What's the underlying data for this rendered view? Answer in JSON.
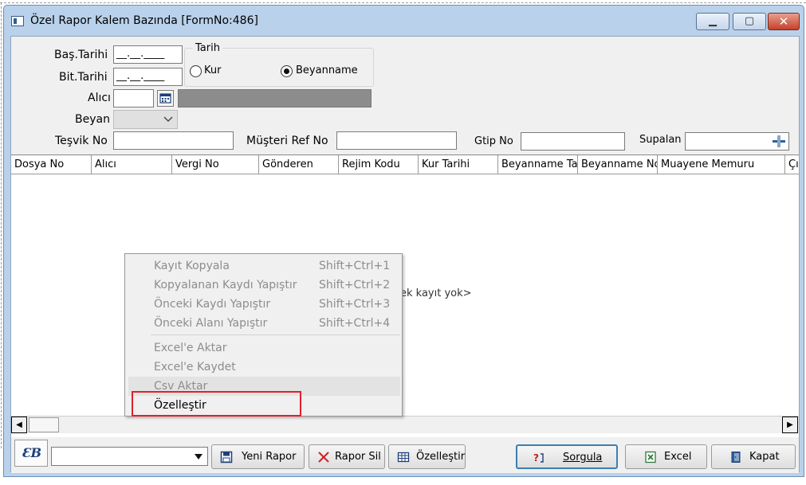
{
  "window": {
    "title": "Özel Rapor Kalem Bazında [FormNo:486]",
    "min_glyph": "▁",
    "max_glyph": "▢",
    "close_glyph": "✕"
  },
  "form": {
    "bas_tarihi_label": "Baş.Tarihi",
    "bas_tarihi_value": "__.__.____",
    "bit_tarihi_label": "Bit.Tarihi",
    "bit_tarihi_value": "__.__.____",
    "tarih_group_label": "Tarih",
    "radio_kur_label": "Kur",
    "radio_beyanname_label": "Beyanname",
    "alici_label": "Alıcı",
    "alici_value": "",
    "beyan_label": "Beyan",
    "tesvik_no_label": "Teşvik No",
    "musteri_ref_no_label": "Müşteri Ref No",
    "gtip_no_label": "Gtip No",
    "supalan_label": "Supalan"
  },
  "grid": {
    "columns": [
      "Dosya No",
      "Alıcı",
      "Vergi No",
      "Gönderen",
      "Rejim Kodu",
      "Kur Tarihi",
      "Beyanname Ta",
      "Beyanname No",
      "Muayene Memuru",
      "Çık"
    ],
    "empty_text": "ek kayıt yok>"
  },
  "context_menu": {
    "items": [
      {
        "label": "Kayıt Kopyala",
        "shortcut": "Shift+Ctrl+1"
      },
      {
        "label": "Kopyalanan Kaydı Yapıştır",
        "shortcut": "Shift+Ctrl+2"
      },
      {
        "label": "Önceki Kaydı Yapıştır",
        "shortcut": "Shift+Ctrl+3"
      },
      {
        "label": "Önceki Alanı Yapıştır",
        "shortcut": "Shift+Ctrl+4"
      },
      {
        "label": "Excel'e Aktar",
        "shortcut": ""
      },
      {
        "label": "Excel'e Kaydet",
        "shortcut": ""
      },
      {
        "label": "Csv Aktar",
        "shortcut": ""
      },
      {
        "label": "Özelleştir",
        "shortcut": ""
      }
    ]
  },
  "toolbar": {
    "logo_text": "ƐB",
    "yeni_rapor": "Yeni Rapor",
    "rapor_sil": "Rapor Sil",
    "ozellestir": "Özelleştir",
    "sorgula": "Sorgula",
    "excel": "Excel",
    "kapat": "Kapat"
  },
  "icons": {
    "calendar": "calendar-icon",
    "dropdown": "chevron-down-icon",
    "save": "floppy-icon",
    "delete": "x-icon",
    "grid": "grid-icon",
    "query": "query-icon",
    "excel": "excel-icon",
    "exit": "door-icon"
  },
  "colors": {
    "window_frame": "#b9d1ea",
    "highlight_box": "#e0202a",
    "disabled_text": "#8d8d8d",
    "gray_field": "#8c8c8c"
  }
}
